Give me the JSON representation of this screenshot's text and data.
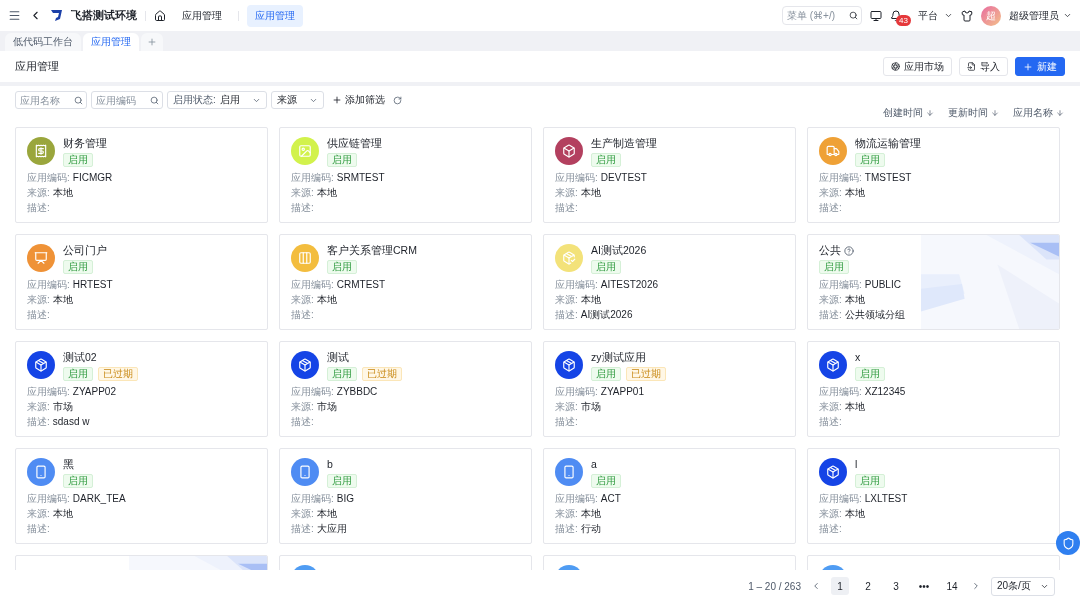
{
  "topbar": {
    "brand": "飞搭测试环境",
    "breadcrumb": "应用管理",
    "active_crumb": "应用管理",
    "search": {
      "placeholder": "菜单 (⌘+/)"
    },
    "notifications": "43",
    "platform": "平台",
    "avatar": "超",
    "user": "超级管理员"
  },
  "tabs": [
    {
      "label": "低代码工作台",
      "selected": false
    },
    {
      "label": "应用管理",
      "selected": true
    }
  ],
  "header": {
    "title": "应用管理",
    "buttons": [
      {
        "label": "应用市场",
        "kind": "market"
      },
      {
        "label": "导入",
        "kind": "import"
      },
      {
        "label": "新建",
        "kind": "create"
      }
    ]
  },
  "filters": [
    {
      "kind": "search",
      "placeholder": "应用名称"
    },
    {
      "kind": "search",
      "placeholder": "应用编码"
    },
    {
      "kind": "select",
      "label": "启用状态:",
      "value": "启用"
    },
    {
      "kind": "select",
      "value": "来源"
    }
  ],
  "add_filter": "添加筛选",
  "sorts": [
    "创建时间",
    "更新时间",
    "应用名称"
  ],
  "cards": [
    {
      "kind": "app",
      "color": "#9aa63c",
      "name": "财务管理",
      "tags": [
        {
          "label": "启用",
          "kind": "enabled"
        }
      ],
      "fields": [
        {
          "label": "应用编码:",
          "value": "FICMGR"
        },
        {
          "label": "来源:",
          "value": "本地"
        },
        {
          "label": "描述:"
        }
      ]
    },
    {
      "kind": "app",
      "color": "#d2f24c",
      "name": "供应链管理",
      "tags": [
        {
          "label": "启用",
          "kind": "enabled"
        }
      ],
      "fields": [
        {
          "label": "应用编码:",
          "value": "SRMTEST"
        },
        {
          "label": "来源:",
          "value": "本地"
        },
        {
          "label": "描述:"
        }
      ]
    },
    {
      "kind": "app",
      "color": "#b3405f",
      "name": "生产制造管理",
      "tags": [
        {
          "label": "启用",
          "kind": "enabled"
        }
      ],
      "fields": [
        {
          "label": "应用编码:",
          "value": "DEVTEST"
        },
        {
          "label": "来源:",
          "value": "本地"
        },
        {
          "label": "描述:"
        }
      ]
    },
    {
      "kind": "app",
      "color": "#efa136",
      "name": "物流运输管理",
      "tags": [
        {
          "label": "启用",
          "kind": "enabled"
        }
      ],
      "fields": [
        {
          "label": "应用编码:",
          "value": "TMSTEST"
        },
        {
          "label": "来源:",
          "value": "本地"
        },
        {
          "label": "描述:"
        }
      ]
    },
    {
      "kind": "app",
      "color": "#ef9237",
      "name": "公司门户",
      "tags": [
        {
          "label": "启用",
          "kind": "enabled"
        }
      ],
      "fields": [
        {
          "label": "应用编码:",
          "value": "HRTEST"
        },
        {
          "label": "来源:",
          "value": "本地"
        },
        {
          "label": "描述:"
        }
      ]
    },
    {
      "kind": "app",
      "color": "#f3bd3e",
      "name": "客户关系管理CRM",
      "tags": [
        {
          "label": "启用",
          "kind": "enabled"
        }
      ],
      "fields": [
        {
          "label": "应用编码:",
          "value": "CRMTEST"
        },
        {
          "label": "来源:",
          "value": "本地"
        },
        {
          "label": "描述:"
        }
      ]
    },
    {
      "kind": "app",
      "color": "#f3e27a",
      "name": "AI测试2026",
      "tags": [
        {
          "label": "启用",
          "kind": "enabled"
        }
      ],
      "fields": [
        {
          "label": "应用编码:",
          "value": "AITEST2026"
        },
        {
          "label": "来源:",
          "value": "本地"
        },
        {
          "label": "描述:",
          "value": "AI测试2026"
        }
      ]
    },
    {
      "kind": "public",
      "name": "公共",
      "tags": [
        {
          "label": "启用",
          "kind": "enabled"
        }
      ],
      "fields": [
        {
          "label": "应用编码:",
          "value": "PUBLIC"
        },
        {
          "label": "来源:",
          "value": "本地"
        },
        {
          "label": "描述:",
          "value": "公共领域分组"
        }
      ]
    },
    {
      "kind": "app",
      "color": "#1544e6",
      "name": "测试02",
      "tags": [
        {
          "label": "启用",
          "kind": "enabled"
        },
        {
          "label": "已过期",
          "kind": "expired"
        }
      ],
      "fields": [
        {
          "label": "应用编码:",
          "value": "ZYAPP02"
        },
        {
          "label": "来源:",
          "value": "市场"
        },
        {
          "label": "描述:",
          "value": "sdasd w"
        }
      ]
    },
    {
      "kind": "app",
      "color": "#1544e6",
      "name": "测试",
      "tags": [
        {
          "label": "启用",
          "kind": "enabled"
        },
        {
          "label": "已过期",
          "kind": "expired"
        }
      ],
      "fields": [
        {
          "label": "应用编码:",
          "value": "ZYBBDC"
        },
        {
          "label": "来源:",
          "value": "市场"
        },
        {
          "label": "描述:"
        }
      ]
    },
    {
      "kind": "app",
      "color": "#1544e6",
      "name": "zy测试应用",
      "tags": [
        {
          "label": "启用",
          "kind": "enabled"
        },
        {
          "label": "已过期",
          "kind": "expired"
        }
      ],
      "fields": [
        {
          "label": "应用编码:",
          "value": "ZYAPP01"
        },
        {
          "label": "来源:",
          "value": "市场"
        },
        {
          "label": "描述:"
        }
      ]
    },
    {
      "kind": "app",
      "color": "#1544e6",
      "name": "x",
      "tags": [
        {
          "label": "启用",
          "kind": "enabled"
        }
      ],
      "fields": [
        {
          "label": "应用编码:",
          "value": "XZ12345"
        },
        {
          "label": "来源:",
          "value": "本地"
        },
        {
          "label": "描述:"
        }
      ]
    },
    {
      "kind": "device",
      "color": "#4f8cf3",
      "name": "黑",
      "tags": [
        {
          "label": "启用",
          "kind": "enabled"
        }
      ],
      "fields": [
        {
          "label": "应用编码:",
          "value": "DARK_TEA"
        },
        {
          "label": "来源:",
          "value": "本地"
        },
        {
          "label": "描述:"
        }
      ]
    },
    {
      "kind": "device",
      "color": "#4f8cf3",
      "name": "b",
      "tags": [
        {
          "label": "启用",
          "kind": "enabled"
        }
      ],
      "fields": [
        {
          "label": "应用编码:",
          "value": "BIG"
        },
        {
          "label": "来源:",
          "value": "本地"
        },
        {
          "label": "描述:",
          "value": "大应用"
        }
      ]
    },
    {
      "kind": "device",
      "color": "#4f8cf3",
      "name": "a",
      "tags": [
        {
          "label": "启用",
          "kind": "enabled"
        }
      ],
      "fields": [
        {
          "label": "应用编码:",
          "value": "ACT"
        },
        {
          "label": "来源:",
          "value": "本地"
        },
        {
          "label": "描述:",
          "value": "行动"
        }
      ]
    },
    {
      "kind": "app",
      "color": "#1544e6",
      "name": "l",
      "tags": [
        {
          "label": "启用",
          "kind": "enabled"
        }
      ],
      "fields": [
        {
          "label": "应用编码:",
          "value": "LXLTEST"
        },
        {
          "label": "来源:",
          "value": "本地"
        },
        {
          "label": "描述:"
        }
      ]
    },
    {
      "kind": "public_cut"
    },
    {
      "kind": "cut",
      "color": "#4f9cf3"
    },
    {
      "kind": "cut",
      "color": "#4f9cf3"
    },
    {
      "kind": "cut",
      "color": "#4f9cf3"
    }
  ],
  "pagination": {
    "range": "1 – 20 / 263",
    "pages": [
      {
        "label": "1",
        "selected": true
      },
      {
        "label": "2",
        "selected": false
      },
      {
        "label": "3",
        "selected": false
      },
      {
        "label": "•••",
        "selected": false
      },
      {
        "label": "14",
        "selected": false
      }
    ],
    "page_size": "20条/页"
  }
}
